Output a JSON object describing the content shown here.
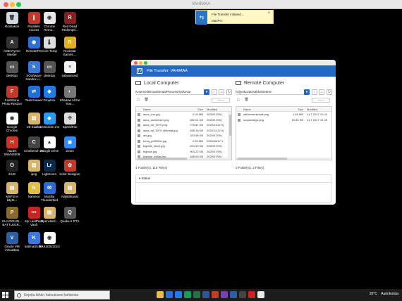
{
  "window": {
    "title": "VAHIMAA"
  },
  "desktop_icons": [
    {
      "label": "Roskakori",
      "color": "#cfd7df",
      "glyph": "🗑"
    },
    {
      "label": "Parallels Access",
      "color": "#c0392b",
      "glyph": "∥"
    },
    {
      "label": "Chrome Remo...",
      "color": "#e8e8e8",
      "glyph": "◉"
    },
    {
      "label": "Red Dead Redemptl...",
      "color": "#8b1e1e",
      "glyph": "R"
    },
    {
      "label": "AMD Ryzen Master",
      "color": "#333333",
      "glyph": "A"
    },
    {
      "label": "RemotePC",
      "color": "#2f6fcf",
      "glyph": "◉"
    },
    {
      "label": "Core Temp",
      "color": "#dddddd",
      "glyph": "🌡"
    },
    {
      "label": "Rockstar Games ...",
      "color": "#e0b020",
      "glyph": "R"
    },
    {
      "label": "desktop",
      "color": "#555555",
      "glyph": "▭"
    },
    {
      "label": "SOoftware Sandra Li...",
      "color": "#3a78d8",
      "glyph": "S"
    },
    {
      "label": "desktop",
      "color": "#555555",
      "glyph": "▭"
    },
    {
      "label": "salasanoed",
      "color": "#f2f2f2",
      "glyph": "≡"
    },
    {
      "label": "FastStone Photo Resizer",
      "color": "#c0392b",
      "glyph": "F"
    },
    {
      "label": "TeamViewer",
      "color": "#1e6fd6",
      "glyph": "⇄"
    },
    {
      "label": "Dropbox",
      "color": "#1e7ce8",
      "glyph": "◆"
    },
    {
      "label": "Shadow of the Tom...",
      "color": "#777777",
      "glyph": "◐"
    },
    {
      "label": "Google Chrome",
      "color": "#ffffff",
      "glyph": "◉"
    },
    {
      "label": "20-21alku",
      "color": "#d6b56a",
      "glyph": "▤"
    },
    {
      "label": "Getscreen.me",
      "color": "#2a9af0",
      "glyph": "◈"
    },
    {
      "label": "SpeedFan",
      "color": "#dddddd",
      "glyph": "✣"
    },
    {
      "label": "Hades Win/NSI/08",
      "color": "#cc3322",
      "glyph": "H"
    },
    {
      "label": "Cinebench 23",
      "color": "#444444",
      "glyph": "C"
    },
    {
      "label": "Google Drive",
      "color": "#ffffff",
      "glyph": "▲"
    },
    {
      "label": "Zoom",
      "color": "#2d8cff",
      "glyph": "◼"
    },
    {
      "label": "iCUE",
      "color": "#222222",
      "glyph": "⏻"
    },
    {
      "label": "ipeg",
      "color": "#d6b56a",
      "glyph": "▤"
    },
    {
      "label": "Lightroom",
      "color": "#0a2a4a",
      "glyph": "Lr"
    },
    {
      "label": "Xolor Designer",
      "color": "#c0392b",
      "glyph": "✿"
    },
    {
      "label": "MSFS ei käytö...",
      "color": "#d6b56a",
      "glyph": "▤"
    },
    {
      "label": "Names4",
      "color": "#e0c040",
      "glyph": "N"
    },
    {
      "label": "Mozilla Thunderbird",
      "color": "#2a6ad8",
      "glyph": "✉"
    },
    {
      "label": "Näyttökuvat",
      "color": "#d6b56a",
      "glyph": "▤"
    },
    {
      "label": "PLAYERUN... BATTLEGR...",
      "color": "#8a6a2a",
      "glyph": "P"
    },
    {
      "label": "My LastPass Vault",
      "color": "#cc2222",
      "glyph": "•••"
    },
    {
      "label": "OpenHard...",
      "color": "#d6b56a",
      "glyph": "▤"
    },
    {
      "label": "Quake II RTX",
      "color": "#555555",
      "glyph": "Q"
    },
    {
      "label": "Oracle VM VirtualBox",
      "color": "#2a5fa8",
      "glyph": "V"
    },
    {
      "label": "katimaStcker",
      "color": "#3a7ae0",
      "glyph": "K"
    },
    {
      "label": "RAK20023013",
      "color": "#ffffff",
      "glyph": "◉"
    }
  ],
  "notification": {
    "title": "File Transfer initiated...",
    "subtitle": "MacPro",
    "close": "×",
    "icon": "transfer-icon"
  },
  "file_transfer": {
    "header_title": "File Transfer: VAHIMAA",
    "local": {
      "title": "Local Computer",
      "path": "/Users/aleksivahimaa/Pictures/työkuvat",
      "send_label": "Send",
      "columns": [
        "Name",
        "Size",
        "Modified"
      ],
      "rows": [
        {
          "name": "asus_zuo.jpg",
          "size": "0.34 MB",
          "modified": "2020/07/09 ("
        },
        {
          "name": "asus_aseitukset.png",
          "size": "682.01 KB",
          "modified": "2020/07/09 ("
        },
        {
          "name": "asus_tuf_3070.png",
          "size": "279.87 KB",
          "modified": "2020/11/12 0("
        },
        {
          "name": "asus_tuf_3070_liitännät.jpg",
          "size": "455.16 KB",
          "modified": "2020/11/12 0("
        },
        {
          "name": "atx.jpg",
          "size": "333.98 KB",
          "modified": "2020/07/09 ("
        },
        {
          "name": "benq_pd3200u.jpg",
          "size": "2.50 MB",
          "modified": "2020/08/17 1"
        },
        {
          "name": "bigblue_kiinni.jpg",
          "size": "694.99 KB",
          "modified": "2020/07/09 ("
        },
        {
          "name": "bigblue.jpg",
          "size": "904.22 KB",
          "modified": "2020/07/09 ("
        },
        {
          "name": "bigblue_mittari.jpg",
          "size": "488.06 KB",
          "modified": "2020/07/09 ("
        }
      ],
      "count": "4 Folder(s), 116 File(s)"
    },
    "remote": {
      "title": "Remote Computer",
      "path": "/Ojtyökuvat/Sähköhteteen",
      "send_label": "Send",
      "columns": [
        "Name",
        "Size",
        "Modified"
      ],
      "rows": [
        {
          "name": "sähkömerkinnät.png",
          "size": "1.65 MB",
          "modified": "14.7.2017 10.24"
        },
        {
          "name": "suojaeristys.png",
          "size": "15.80 KB",
          "modified": "14.7.2017 10.25"
        }
      ],
      "count": "0 Folder(s), 2 File(s)"
    },
    "status_label": "Status"
  },
  "taskbar": {
    "search_placeholder": "Kirjoita tähän hakeaksesi kohteista",
    "weather": "20°C",
    "weather_desc": "Aurinkoista",
    "app_colors": [
      "#f2b84b",
      "#2a6fd8",
      "#1e7ce8",
      "#0f9d58",
      "#217346",
      "#2b579a",
      "#c43e1c",
      "#7b3fb5",
      "#2a5fa8",
      "#444444",
      "#cc2222",
      "#e8e8e8"
    ]
  }
}
